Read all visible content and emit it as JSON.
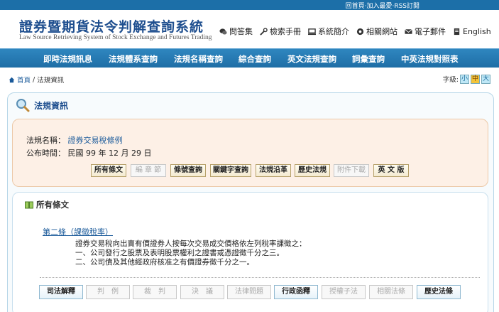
{
  "top_links": "回首頁‧加入最愛‧RSS訂閱",
  "site": {
    "title": "證券暨期貨法令判解查詢系統",
    "subtitle": "Law Source Retrieving System of Stock Exchange and Futures Trading"
  },
  "header_links": [
    {
      "label": "問答集",
      "icon": "chat-icon"
    },
    {
      "label": "檢索手冊",
      "icon": "wrench-icon"
    },
    {
      "label": "系統簡介",
      "icon": "computer-icon"
    },
    {
      "label": "相關網站",
      "icon": "globe-icon"
    },
    {
      "label": "電子郵件",
      "icon": "mail-icon"
    },
    {
      "label": "English",
      "icon": "document-icon"
    }
  ],
  "nav": [
    "即時法規訊息",
    "法規體系查詢",
    "法規名稱查詢",
    "綜合查詢",
    "英文法規查詢",
    "詞彙查詢",
    "中英法規對照表"
  ],
  "breadcrumb": {
    "home": "首頁",
    "sep": "/",
    "current": "法規資訊"
  },
  "font_size": {
    "label": "字級:",
    "small": "小",
    "medium": "中",
    "large": "大"
  },
  "panel": {
    "title": "法規資訊"
  },
  "info": {
    "name_label": "法規名稱：",
    "name_value": "證券交易稅條例",
    "date_label": "公布時間：",
    "date_value": "民國 99 年 12 月 29 日"
  },
  "info_buttons": [
    {
      "label": "所有條文",
      "enabled": true
    },
    {
      "label": "編 章 節",
      "enabled": false
    },
    {
      "label": "條號查詢",
      "enabled": true
    },
    {
      "label": "關鍵字查詢",
      "enabled": true
    },
    {
      "label": "法規沿革",
      "enabled": true
    },
    {
      "label": "歷史法規",
      "enabled": true
    },
    {
      "label": "附件下載",
      "enabled": false
    },
    {
      "label": "英 文 版",
      "enabled": true
    }
  ],
  "law": {
    "section_title": "所有條文",
    "article_link": "第二條（課徵稅率）",
    "article_lines": [
      "證券交易稅向出賣有價證券人按每次交易成交價格依左列稅率課徵之：",
      "一、公司發行之股票及表明股票權利之證書或憑證徵千分之三。",
      "二、公司債及其他經政府核准之有價證券徵千分之一。"
    ]
  },
  "bottom_buttons": [
    {
      "label": "司法解釋",
      "enabled": true
    },
    {
      "label": "判　例",
      "enabled": false
    },
    {
      "label": "裁　判",
      "enabled": false
    },
    {
      "label": "決　議",
      "enabled": false
    },
    {
      "label": "法律問題",
      "enabled": false
    },
    {
      "label": "行政函釋",
      "enabled": true
    },
    {
      "label": "授權子法",
      "enabled": false
    },
    {
      "label": "相關法條",
      "enabled": false
    },
    {
      "label": "歷史法條",
      "enabled": true
    }
  ],
  "colors": {
    "brand": "#1f4f8f",
    "nav_bg": "#2577b0",
    "info_bg": "#fdf0e6"
  }
}
